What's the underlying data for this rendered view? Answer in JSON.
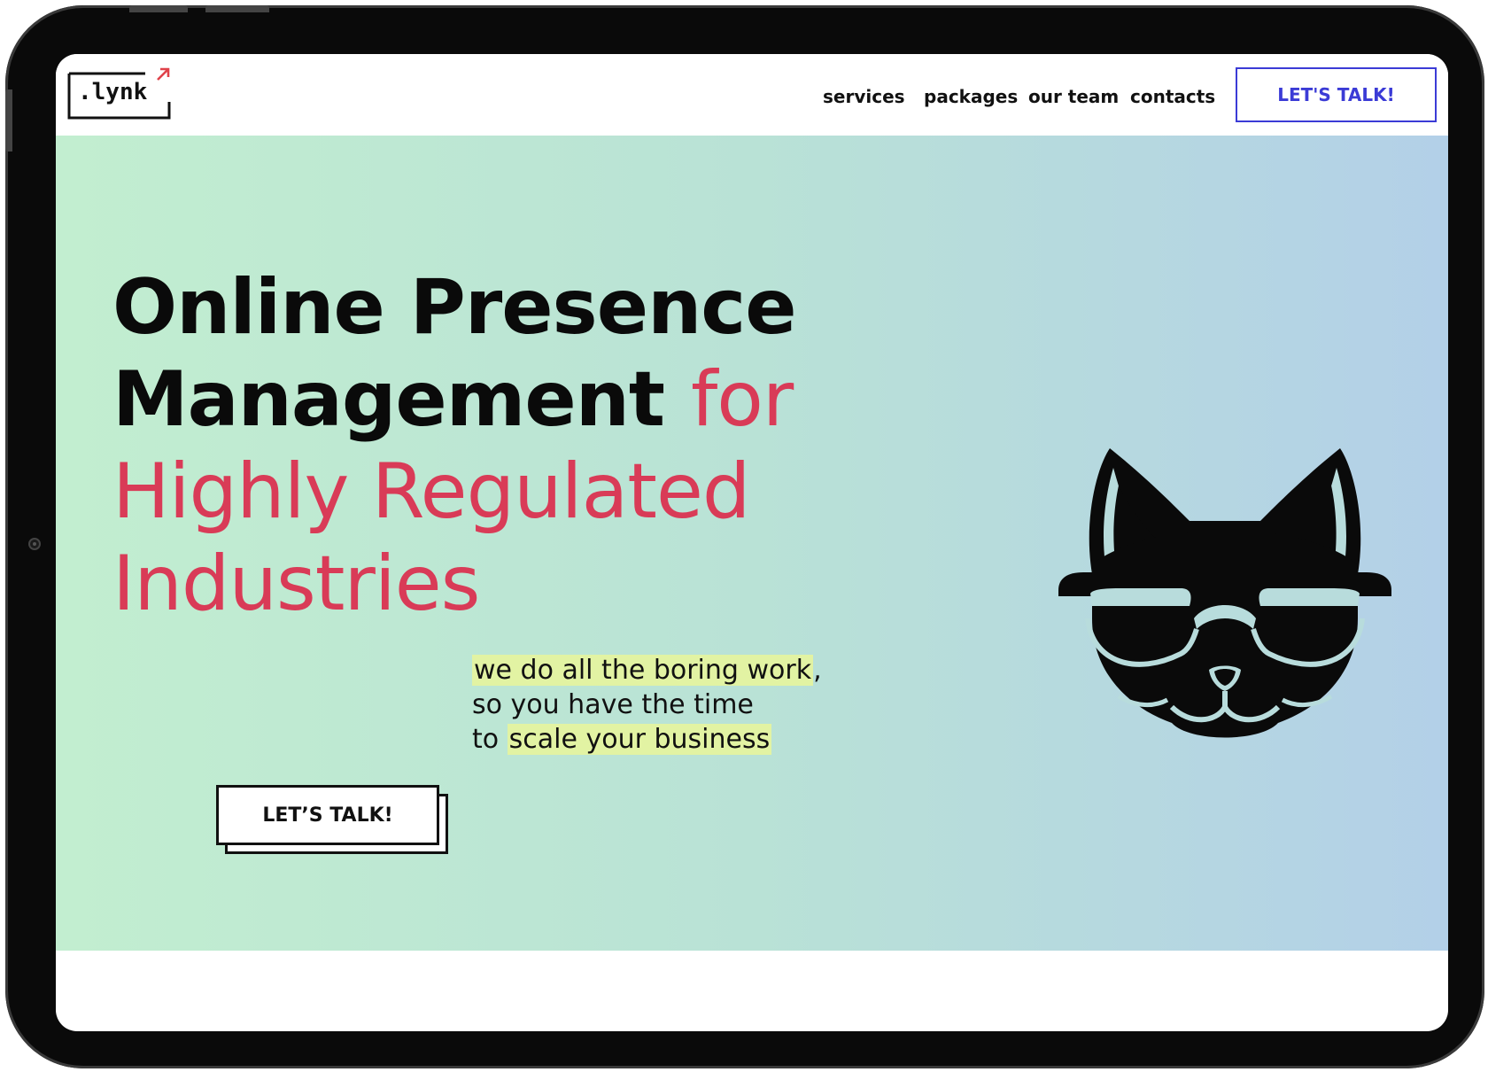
{
  "brand": {
    "logo_text": ".lynk",
    "logo_arrow_color": "#e0424a"
  },
  "nav": {
    "links": [
      "services",
      "packages",
      "our team",
      "contacts"
    ],
    "cta_label": "LET'S TALK!",
    "cta_color": "#3b3bd6"
  },
  "hero": {
    "headline_dark_1": "Online Presence",
    "headline_dark_2": "Management",
    "headline_accent_1": "for",
    "headline_accent_2": "Highly Regulated",
    "headline_accent_3": "Industries",
    "accent_color": "#d93b57",
    "tagline_hl_1": "we do all the boring work",
    "tagline_after_1": ",",
    "tagline_line_2": "so you have the time",
    "tagline_prefix_3": "to",
    "tagline_hl_3": "scale your business",
    "highlight_color": "#e2f3a3",
    "cta_label": "LET’S TALK!",
    "mascot_icon": "cat-with-sunglasses-icon",
    "gradient": [
      "#c2eed0",
      "#b9e2d6",
      "#b3d0e8"
    ]
  }
}
